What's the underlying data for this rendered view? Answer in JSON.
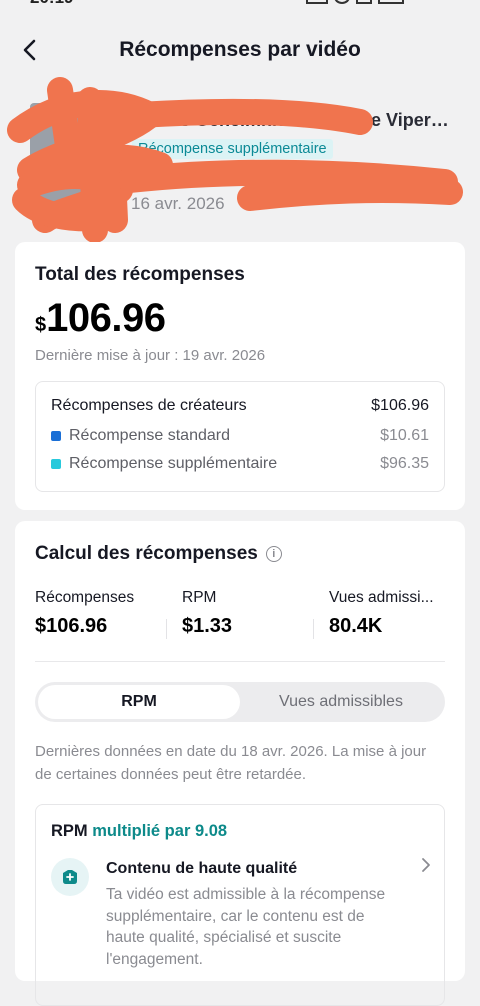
{
  "status": {
    "time": "20:19"
  },
  "header": {
    "title": "Récompenses par vidéo"
  },
  "video": {
    "title": "...s Geheimnis der Dodge Viper – ...",
    "tag": "Récompense supplémentaire",
    "date": "16 avr. 2026"
  },
  "total": {
    "title": "Total des récompenses",
    "currency": "$",
    "amount": "106.96",
    "updated": "Dernière mise à jour : 19 avr. 2026",
    "breakdown": [
      {
        "label": "Récompenses de créateurs",
        "value": "$106.96",
        "color": ""
      },
      {
        "label": "Récompense standard",
        "value": "$10.61",
        "color": "#1a6fd6"
      },
      {
        "label": "Récompense supplémentaire",
        "value": "$96.35",
        "color": "#28c9dc"
      }
    ]
  },
  "calc": {
    "title": "Calcul des récompenses",
    "info_icon": "info-icon",
    "stats": [
      {
        "label": "Récompenses",
        "value": "$106.96"
      },
      {
        "label": "RPM",
        "value": "$1.33"
      },
      {
        "label": "Vues admissi...",
        "value": "80.4K"
      }
    ],
    "tabs": [
      {
        "label": "RPM",
        "active": true
      },
      {
        "label": "Vues admissibles",
        "active": false
      }
    ],
    "note": "Dernières données en date du 18 avr. 2026. La mise à jour de certaines données peut être retardée.",
    "rpm_box": {
      "prefix": "RPM",
      "multiplier": "multiplié par 9.08",
      "item_title": "Contenu de haute qualité",
      "item_desc": "Ta vidéo est admissible à la récompense supplémentaire, car le contenu est de haute qualité, spécialisé et suscite l'engagement."
    }
  },
  "colors": {
    "accent_teal": "#0d8a8a",
    "redaction": "#f0744e"
  }
}
